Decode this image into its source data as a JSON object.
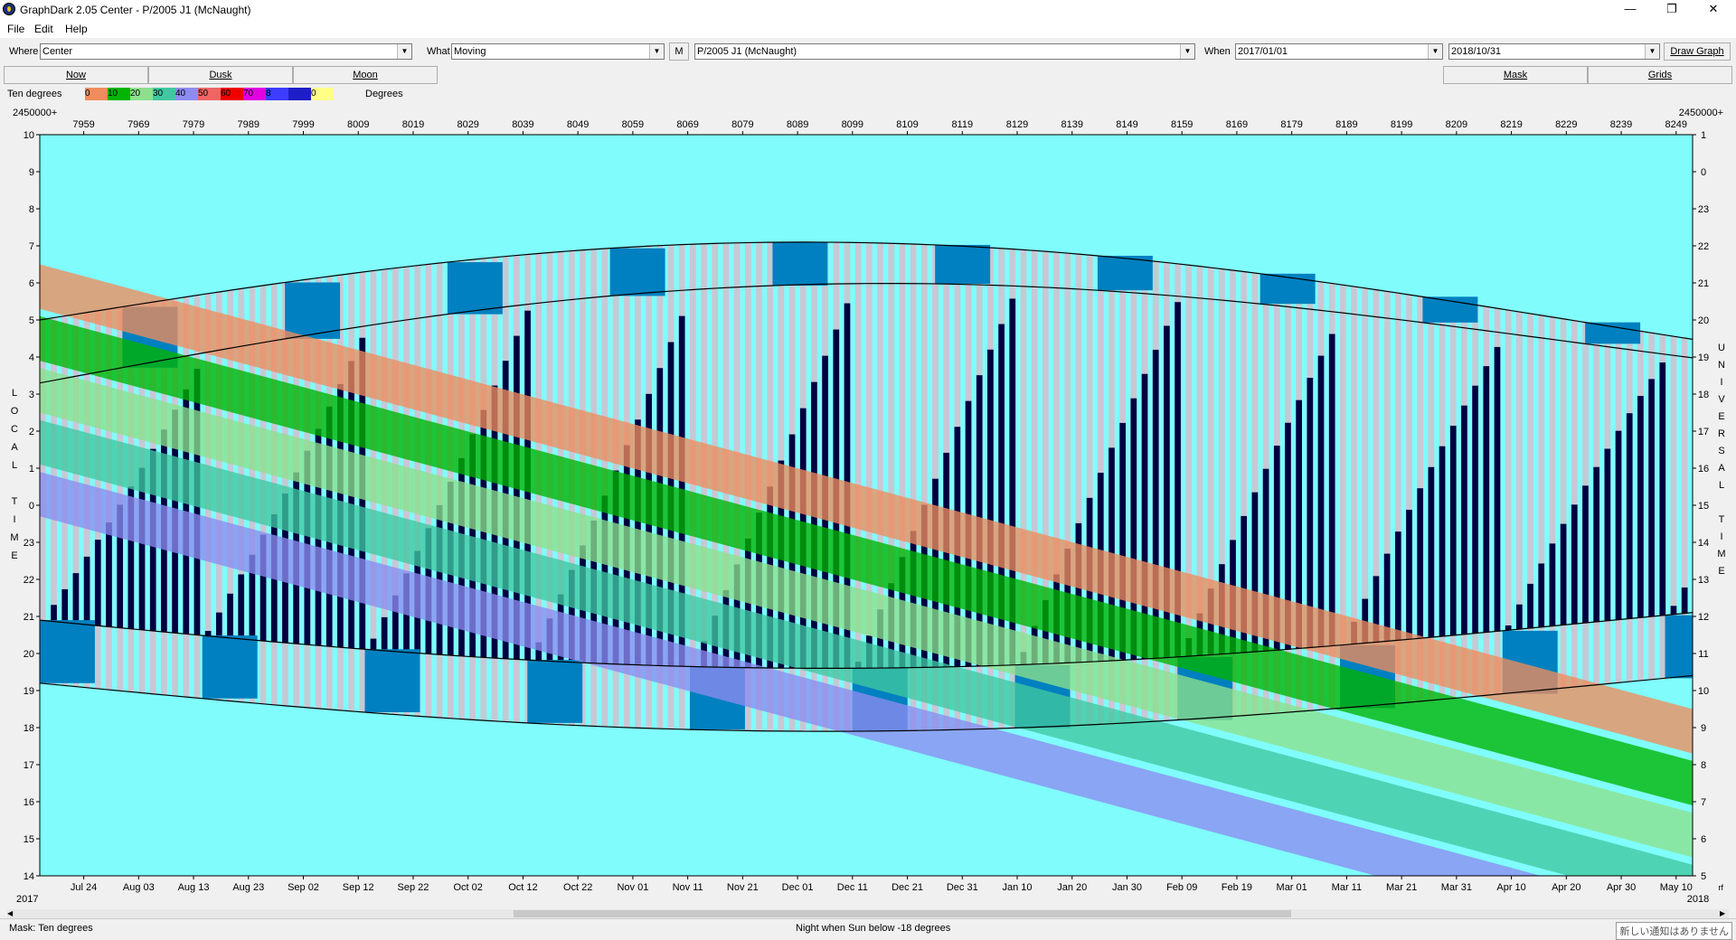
{
  "window": {
    "title": "GraphDark 2.05  Center  -  P/2005 J1 (McNaught)",
    "minimize": "—",
    "restore": "❐",
    "close": "✕"
  },
  "menu": [
    "File",
    "Edit",
    "Help"
  ],
  "toolbar": {
    "where_label": "Where",
    "where_value": "Center",
    "what_label": "What",
    "what_value": "Moving",
    "m_button": "M",
    "object_value": "P/2005 J1 (McNaught)",
    "when_label": "When",
    "when_start": "2017/01/01",
    "when_end": "2018/10/31",
    "draw_graph": "Draw Graph"
  },
  "buttons": {
    "now": "Now",
    "dusk": "Dusk",
    "moon": "Moon",
    "mask": "Mask",
    "grids": "Grids"
  },
  "legend": {
    "label": "Ten degrees",
    "units": "Degrees",
    "colors": [
      "#f08c5c",
      "#00b400",
      "#8ce08c",
      "#40c8a0",
      "#8c8cf0",
      "#f06464",
      "#f00000",
      "#e000e0",
      "#3c3cff",
      "#1e1ec8",
      "#ffff88"
    ],
    "values": [
      "0",
      "10",
      "20",
      "30",
      "40",
      "50",
      "60",
      "70",
      "8",
      "",
      "0"
    ]
  },
  "graph": {
    "jd_prefix": "2450000+",
    "jd_ticks": [
      "7959",
      "7969",
      "7979",
      "7989",
      "7999",
      "8009",
      "8019",
      "8029",
      "8039",
      "8049",
      "8059",
      "8069",
      "8079",
      "8089",
      "8099",
      "8109",
      "8119",
      "8129",
      "8139",
      "8149",
      "8159",
      "8169",
      "8179",
      "8189",
      "8199",
      "8209",
      "8219",
      "8229",
      "8239",
      "8249"
    ],
    "date_ticks": [
      "Jul 24",
      "Aug 03",
      "Aug 13",
      "Aug 23",
      "Sep 02",
      "Sep 12",
      "Sep 22",
      "Oct 02",
      "Oct 12",
      "Oct 22",
      "Nov 01",
      "Nov 11",
      "Nov 21",
      "Dec 01",
      "Dec 11",
      "Dec 21",
      "Dec 31",
      "Jan 10",
      "Jan 20",
      "Jan 30",
      "Feb 09",
      "Feb 19",
      "Mar 01",
      "Mar 11",
      "Mar 21",
      "Mar 31",
      "Apr 10",
      "Apr 20",
      "Apr 30",
      "May 10"
    ],
    "year_left": "2017",
    "year_right": "2018",
    "left_ticks": [
      "10",
      "9",
      "8",
      "7",
      "6",
      "5",
      "4",
      "3",
      "2",
      "1",
      "0",
      "23",
      "22",
      "21",
      "20",
      "19",
      "18",
      "17",
      "16",
      "15",
      "14"
    ],
    "right_ticks": [
      "1",
      "0",
      "23",
      "22",
      "21",
      "20",
      "19",
      "18",
      "17",
      "16",
      "15",
      "14",
      "13",
      "12",
      "11",
      "10",
      "9",
      "8",
      "7",
      "6",
      "5"
    ],
    "left_axis_title": [
      "L",
      "O",
      "C",
      "A",
      "L",
      "",
      "T",
      "I",
      "M",
      "E"
    ],
    "right_axis_title": [
      "U",
      "N",
      "I",
      "V",
      "E",
      "R",
      "S",
      "A",
      "L",
      "",
      "T",
      "I",
      "M",
      "E"
    ],
    "right_corner": "rf",
    "colors": {
      "background": "#80fcfc",
      "night": "#000040",
      "twilight": "#c8c8d4",
      "moonlit": "#0080c0"
    }
  },
  "status": {
    "mask": "Mask:  Ten degrees",
    "night": "Night when Sun below -18 degrees",
    "notification": "新しい通知はありません"
  }
}
